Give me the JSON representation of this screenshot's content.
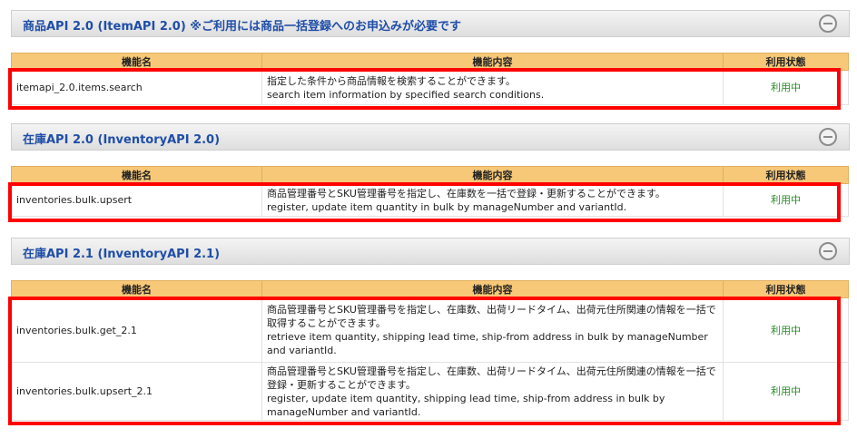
{
  "columns": {
    "name": "機能名",
    "desc": "機能内容",
    "status": "利用状態"
  },
  "sections": [
    {
      "title": "商品API 2.0 (ItemAPI 2.0) ※ご利用には商品一括登録へのお申込みが必要です",
      "rows": [
        {
          "name": "itemapi_2.0.items.search",
          "desc_jp": "指定した条件から商品情報を検索することができます。",
          "desc_en": "search item information by specified search conditions.",
          "status": "利用中"
        }
      ]
    },
    {
      "title": "在庫API 2.0 (InventoryAPI 2.0)",
      "rows": [
        {
          "name": "inventories.bulk.upsert",
          "desc_jp": "商品管理番号とSKU管理番号を指定し、在庫数を一括で登録・更新することができます。",
          "desc_en": "register, update item quantity in bulk by manageNumber and variantId.",
          "status": "利用中"
        }
      ]
    },
    {
      "title": "在庫API 2.1 (InventoryAPI 2.1)",
      "rows": [
        {
          "name": "inventories.bulk.get_2.1",
          "desc_jp": "商品管理番号とSKU管理番号を指定し、在庫数、出荷リードタイム、出荷元住所関連の情報を一括で取得することができます。",
          "desc_en": "retrieve item quantity, shipping lead time, ship-from address in bulk by manageNumber and variantId.",
          "status": "利用中"
        },
        {
          "name": "inventories.bulk.upsert_2.1",
          "desc_jp": "商品管理番号とSKU管理番号を指定し、在庫数、出荷リードタイム、出荷元住所関連の情報を一括で登録・更新することができます。",
          "desc_en": "register, update item quantity, shipping lead time, ship-from address in bulk by manageNumber and variantId.",
          "status": "利用中"
        }
      ]
    }
  ]
}
